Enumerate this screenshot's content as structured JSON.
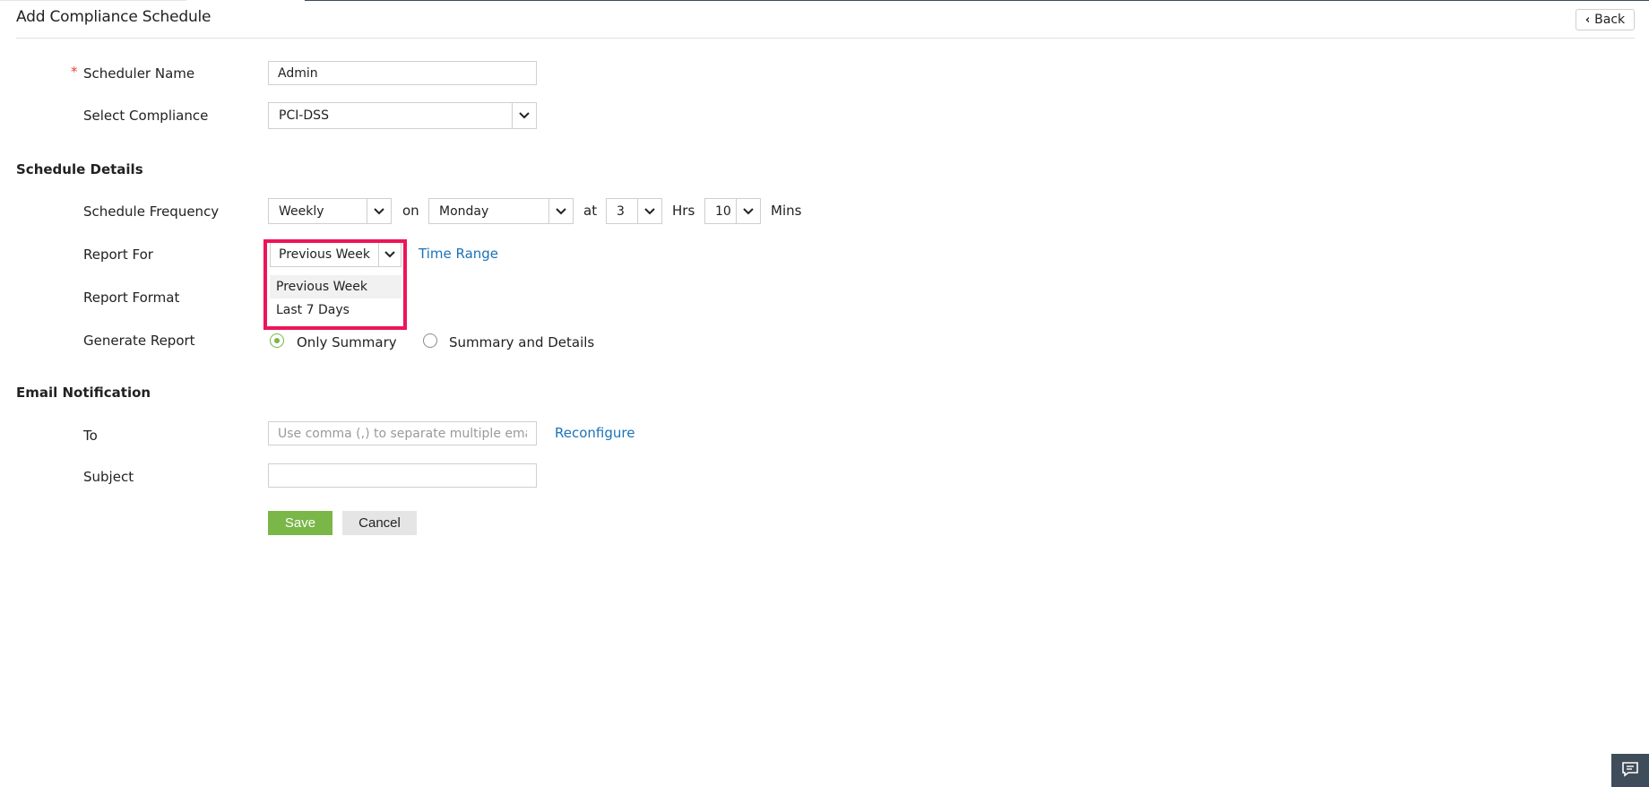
{
  "header": {
    "title": "Add Compliance Schedule",
    "back_label": "Back"
  },
  "form": {
    "scheduler_name": {
      "label": "Scheduler Name",
      "required_mark": "*",
      "value": "Admin"
    },
    "select_compliance": {
      "label": "Select Compliance",
      "value": "PCI-DSS"
    }
  },
  "schedule_details": {
    "heading": "Schedule Details",
    "frequency": {
      "label": "Schedule Frequency",
      "value": "Weekly",
      "on_text": "on",
      "day": "Monday",
      "at_text": "at",
      "hours": "3",
      "hrs_text": "Hrs",
      "minutes": "10",
      "mins_text": "Mins"
    },
    "report_for": {
      "label": "Report For",
      "value": "Previous Week",
      "options": [
        "Previous Week",
        "Last 7 Days"
      ],
      "time_range_link": "Time Range"
    },
    "report_format": {
      "label": "Report Format"
    },
    "generate_report": {
      "label": "Generate Report",
      "options": [
        "Only Summary",
        "Summary and Details"
      ],
      "selected": "Only Summary"
    }
  },
  "email_notification": {
    "heading": "Email Notification",
    "to": {
      "label": "To",
      "placeholder": "Use comma (,) to separate multiple emails",
      "value": ""
    },
    "reconfigure_link": "Reconfigure",
    "subject": {
      "label": "Subject",
      "value": ""
    }
  },
  "actions": {
    "save_label": "Save",
    "cancel_label": "Cancel"
  },
  "icons": {
    "back": "chevron-left-icon",
    "dropdown": "chevron-down-icon",
    "feedback": "chat-icon"
  },
  "colors": {
    "accent_green": "#7ab648",
    "link_blue": "#1a73b8",
    "highlight": "#ec1559",
    "required": "#e0443a",
    "dark_bar": "#3f4d5a"
  }
}
